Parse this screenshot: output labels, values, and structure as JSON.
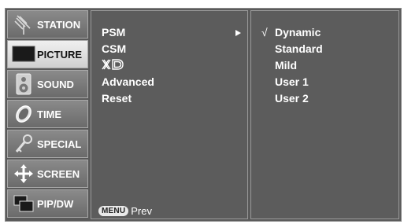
{
  "categories": [
    {
      "label": "STATION",
      "icon": "antenna-icon",
      "active": false
    },
    {
      "label": "PICTURE",
      "icon": "tv-screen-icon",
      "active": true
    },
    {
      "label": "SOUND",
      "icon": "speaker-icon",
      "active": false
    },
    {
      "label": "TIME",
      "icon": "clock-icon",
      "active": false
    },
    {
      "label": "SPECIAL",
      "icon": "key-icon",
      "active": false
    },
    {
      "label": "SCREEN",
      "icon": "move-arrows-icon",
      "active": false
    },
    {
      "label": "PIP/DW",
      "icon": "pip-window-icon",
      "active": false
    }
  ],
  "menu": {
    "items": [
      "PSM",
      "CSM",
      "XD",
      "Advanced",
      "Reset"
    ],
    "selected": "PSM"
  },
  "submenu": {
    "checkmark": "√",
    "items": [
      "Dynamic",
      "Standard",
      "Mild",
      "User 1",
      "User 2"
    ],
    "selected": "Dynamic"
  },
  "footer": {
    "key": "MENU",
    "label": "Prev"
  },
  "colors": {
    "background": "#5a5a5a",
    "active_category": "#e0e0e0",
    "text": "#ffffff"
  }
}
